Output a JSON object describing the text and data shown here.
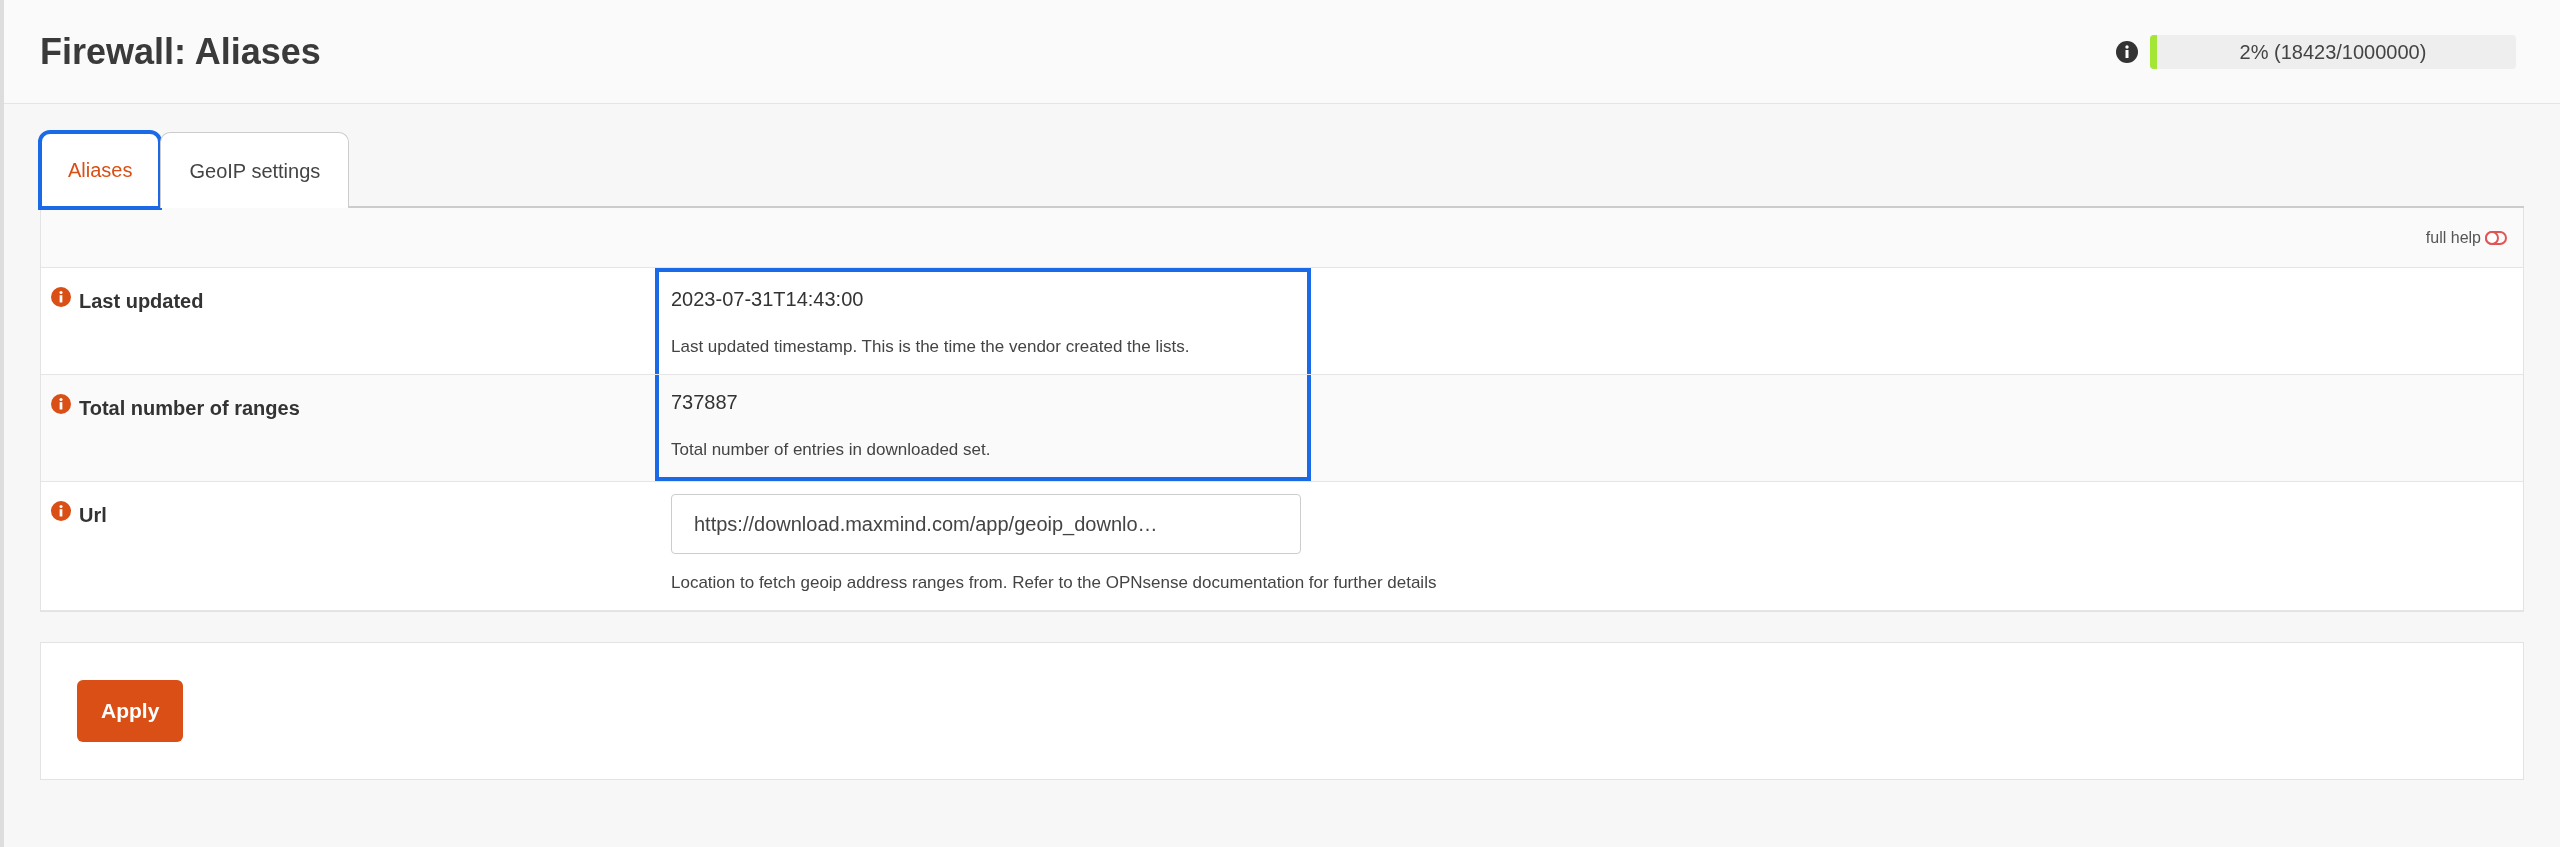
{
  "page_title": "Firewall: Aliases",
  "usage": {
    "level": 0.02,
    "reading": "2% (18423/1000000)"
  },
  "tabs": [
    {
      "label": "Aliases",
      "selected": true,
      "highlighted": true
    },
    {
      "label": "GeoIP settings",
      "selected": false,
      "highlighted": false
    }
  ],
  "full_help": {
    "label": "full help",
    "on": false
  },
  "rows": [
    {
      "kind": "static",
      "label": "Last updated",
      "value": "2023-07-31T14:43:00",
      "help": "Last updated timestamp. This is the time the vendor created the lists.",
      "highlighted": true
    },
    {
      "kind": "static",
      "label": "Total number of ranges",
      "value": "737887",
      "help": "Total number of entries in downloaded set.",
      "highlighted": true
    },
    {
      "kind": "input",
      "label": "Url",
      "value": "https://download.maxmind.com/app/geoip_downlo…",
      "help": "Location to fetch geoip address ranges from. Refer to the OPNsense documentation for further details",
      "highlighted": false
    }
  ],
  "buttons": [
    "Apply"
  ]
}
